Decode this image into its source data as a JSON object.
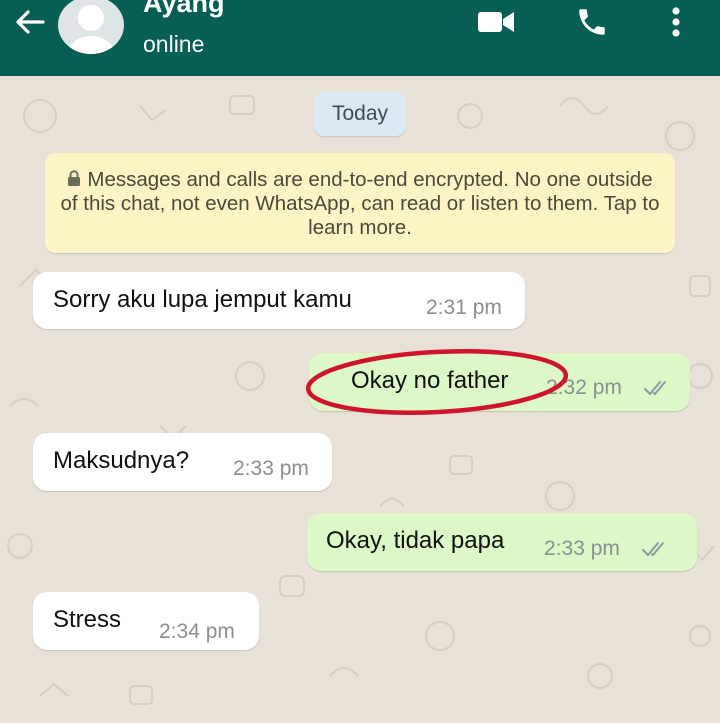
{
  "header": {
    "contact_name": "Ayang",
    "status": "online",
    "accent_color": "#075e54",
    "icons": [
      "back-arrow-icon",
      "avatar-placeholder",
      "video-call-icon",
      "phone-icon",
      "more-options-icon"
    ]
  },
  "chat": {
    "date_label": "Today",
    "encryption_notice": "Messages and calls are end-to-end encrypted. No one outside of this chat, not even WhatsApp, can read or listen to them. Tap to learn more.",
    "messages": [
      {
        "direction": "incoming",
        "text": "Sorry aku lupa jemput kamu",
        "time": "2:31 pm"
      },
      {
        "direction": "outgoing",
        "text": "Okay no father",
        "time": "2:32 pm",
        "status": "read"
      },
      {
        "direction": "incoming",
        "text": "Maksudnya?",
        "time": "2:33 pm"
      },
      {
        "direction": "outgoing",
        "text": "Okay, tidak papa",
        "time": "2:33 pm",
        "status": "read"
      },
      {
        "direction": "incoming",
        "text": "Stress",
        "time": "2:34 pm"
      }
    ],
    "annotation": {
      "type": "red-ellipse",
      "target_message": 1,
      "color": "#d0142c"
    },
    "colors": {
      "incoming_bubble": "#ffffff",
      "outgoing_bubble": "#dcf8c6",
      "date_chip": "#dbe9f4",
      "notice_bg": "#fdf4c5"
    }
  }
}
